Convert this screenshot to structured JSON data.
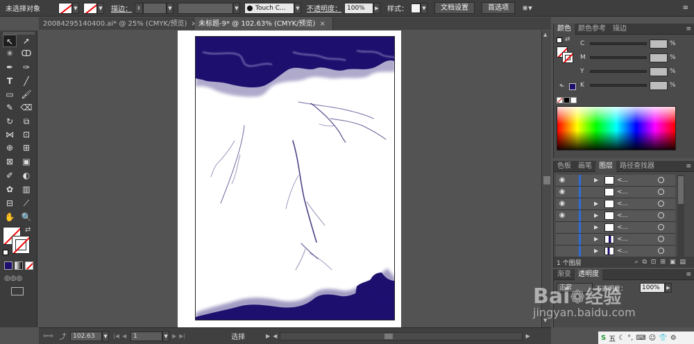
{
  "control_bar": {
    "selection_status": "未选择对象",
    "stroke_label": "描边：",
    "brush_name": "Touch C...",
    "opacity_label": "不透明度：",
    "opacity_value": "100%",
    "style_label": "样式：",
    "doc_setup_button": "文档设置",
    "preferences_button": "首选项"
  },
  "tabs": [
    {
      "label": "20084295140400.ai* @ 25% (CMYK/预览)",
      "close": "×"
    },
    {
      "label": "未标题-9* @ 102.63% (CMYK/预览)",
      "close": "×"
    }
  ],
  "status": {
    "zoom": "102.63",
    "page": "1",
    "mode": "选择"
  },
  "color_panel": {
    "tabs": [
      "颜色",
      "颜色参考",
      "描边"
    ],
    "channels": [
      {
        "name": "C",
        "unit": "%"
      },
      {
        "name": "M",
        "unit": "%"
      },
      {
        "name": "Y",
        "unit": "%"
      },
      {
        "name": "K",
        "unit": "%"
      }
    ]
  },
  "layers_panel": {
    "tabs": [
      "色板",
      "画笔",
      "图层",
      "路径查找器"
    ],
    "rows": [
      {
        "name": "<...",
        "visible": true,
        "expandable": true
      },
      {
        "name": "<...",
        "visible": true,
        "expandable": false
      },
      {
        "name": "<...",
        "visible": true,
        "expandable": true
      },
      {
        "name": "<...",
        "visible": true,
        "expandable": true
      },
      {
        "name": "<...",
        "visible": false,
        "expandable": true
      },
      {
        "name": "<...",
        "visible": false,
        "expandable": true
      },
      {
        "name": "<...",
        "visible": false,
        "expandable": true
      }
    ],
    "layer_count": "1 个图层"
  },
  "transparency_panel": {
    "tabs": [
      "渐变",
      "透明度"
    ],
    "blend_mode": "正常",
    "opacity_label": "不透明度：",
    "opacity_value": "100%"
  },
  "watermark": {
    "brand": "Bai",
    "brand_tail": "经验",
    "url": "jingyan.baidu.com"
  },
  "taskbar": {
    "ime": "五"
  },
  "colors": {
    "cloud": "#1c0f6e",
    "accent_orange": "#f0a030",
    "layer_blue": "#2f6cd8"
  }
}
